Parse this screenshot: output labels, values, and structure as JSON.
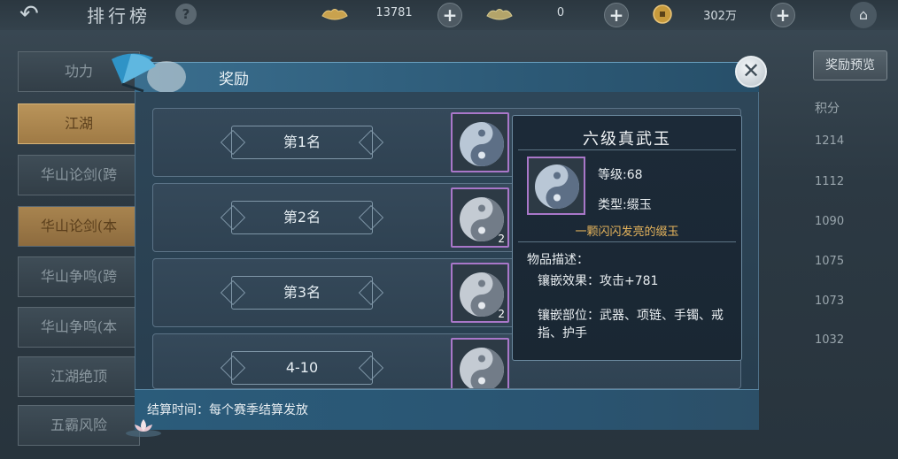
{
  "header": {
    "back_icon": "back-arrow-icon",
    "title": "排行榜",
    "help_label": "?",
    "currencies": [
      {
        "icon": "gold-ingot-icon",
        "amount": "13781"
      },
      {
        "icon": "bound-ingot-icon",
        "amount": "0"
      },
      {
        "icon": "coin-icon",
        "amount": "302万"
      }
    ],
    "plus_label": "+",
    "home_icon": "home-icon"
  },
  "sidebar": {
    "tabs": [
      {
        "label": "功力"
      },
      {
        "label": "江湖"
      },
      {
        "label": "华山论剑(跨"
      },
      {
        "label": "华山论剑(本"
      },
      {
        "label": "华山争鸣(跨"
      },
      {
        "label": "华山争鸣(本"
      },
      {
        "label": "江湖绝顶"
      },
      {
        "label": "五霸风险"
      }
    ]
  },
  "right_panel": {
    "preview_button": "奖励预览",
    "score_header": "积分",
    "scores": [
      "1214",
      "1112",
      "1090",
      "1075",
      "1073",
      "1032"
    ]
  },
  "modal": {
    "title": "奖励",
    "close_label": "✕",
    "ranks": [
      {
        "label": "第1名",
        "count": ""
      },
      {
        "label": "第2名",
        "count": "2"
      },
      {
        "label": "第3名",
        "count": "2"
      },
      {
        "label": "4-10",
        "count": ""
      }
    ],
    "settle_text": "结算时间：每个赛季结算发放"
  },
  "tooltip": {
    "title": "六级真武玉",
    "level": "等级:68",
    "type": "类型:缀玉",
    "flavor": "一颗闪闪发亮的缀玉",
    "desc_label": "物品描述：",
    "effect": "镶嵌效果：攻击+781",
    "slots": "镶嵌部位：武器、项链、手镯、戒指、护手"
  },
  "colors": {
    "accent_purple": "#a977c9",
    "title_bar_blue": "#3a6e8e",
    "active_tab_gold": "#b9945a",
    "flavor_gold": "#e6b45c"
  }
}
